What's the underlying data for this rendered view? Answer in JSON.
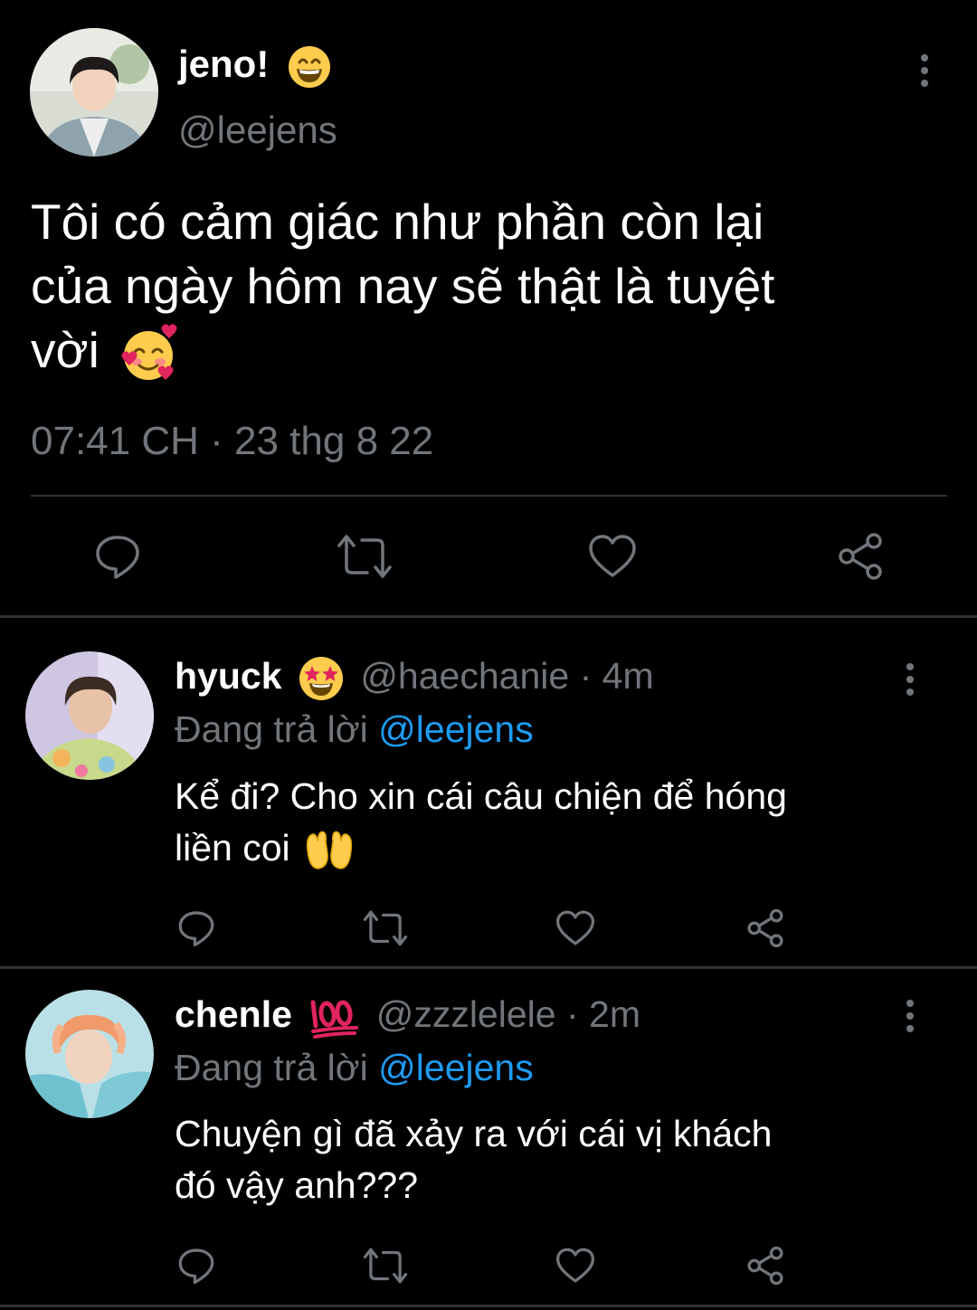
{
  "main_tweet": {
    "display_name": "jeno!",
    "name_emoji": "grinning-face-with-smiling-eyes",
    "handle": "@leejens",
    "text_line1": "Tôi có cảm giác như phần còn lại",
    "text_line2": "của ngày hôm nay sẽ thật là tuyệt",
    "text_line3": "vời",
    "text_emoji": "smiling-face-with-hearts",
    "time": "07:41 CH",
    "separator": "·",
    "date": "23 thg 8 22"
  },
  "replies": [
    {
      "display_name": "hyuck",
      "name_emoji": "star-struck",
      "handle": "@haechanie",
      "separator": "·",
      "time": "4m",
      "replying_label": "Đang trả lời",
      "replying_to": "@leejens",
      "text_line1": "Kể đi? Cho xin cái câu chiện để hóng",
      "text_line2": "liền coi",
      "text_emoji": "palms-up-together"
    },
    {
      "display_name": "chenle",
      "name_emoji": "hundred-points",
      "handle": "@zzzlelele",
      "separator": "·",
      "time": "2m",
      "replying_label": "Đang trả lời",
      "replying_to": "@leejens",
      "text_line1": "Chuyện gì đã xảy ra với cái vị khách",
      "text_line2": "đó vậy anh???"
    }
  ],
  "icons": {
    "reply": "reply-bubble-icon",
    "retweet": "retweet-icon",
    "like": "heart-icon",
    "share": "share-icon",
    "more": "more-vertical-icon"
  },
  "colors": {
    "background": "#000000",
    "text_primary": "#e7e9ea",
    "text_secondary": "#71767b",
    "accent_link": "#1d9bf0",
    "divider": "#2f3336"
  }
}
